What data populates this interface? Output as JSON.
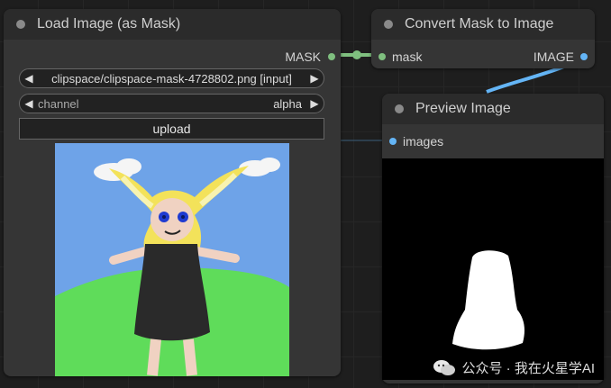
{
  "nodes": {
    "load_image": {
      "title": "Load Image (as Mask)",
      "output_label": "MASK",
      "image_widget": {
        "value": "clipspace/clipspace-mask-4728802.png [input]"
      },
      "channel_widget": {
        "label": "channel",
        "value": "alpha"
      },
      "upload_label": "upload"
    },
    "convert": {
      "title": "Convert Mask to Image",
      "input_label": "mask",
      "output_label": "IMAGE"
    },
    "preview": {
      "title": "Preview Image",
      "input_label": "images"
    }
  },
  "colors": {
    "mask_link": "#7fbf7f",
    "image_link": "#64b5f6",
    "node_body": "#353535",
    "node_header": "#2b2b2b"
  },
  "watermark": {
    "text": "公众号 · 我在火星学AI",
    "icon": "wechat-icon"
  }
}
